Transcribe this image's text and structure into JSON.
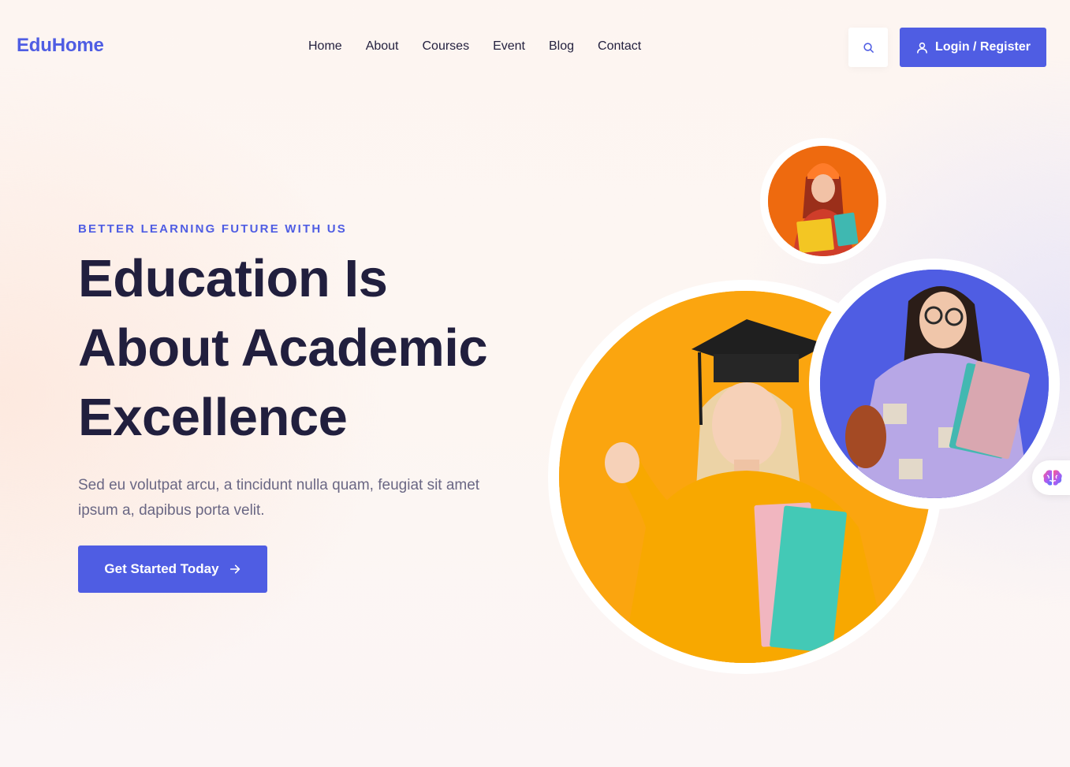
{
  "header": {
    "logo": "EduHome",
    "nav": [
      "Home",
      "About",
      "Courses",
      "Event",
      "Blog",
      "Contact"
    ],
    "login_label": "Login / Register"
  },
  "hero": {
    "eyebrow": "BETTER LEARNING FUTURE WITH US",
    "headline": [
      "Education Is",
      "About Academic",
      "Excellence"
    ],
    "description": "Sed eu volutpat arcu, a tincidunt nulla quam, feugiat sit amet ipsum a, dapibus porta velit.",
    "cta_label": "Get Started Today"
  },
  "images": {
    "small": "student-orange-beanie",
    "big": "student-graduation-cap",
    "mid": "student-glasses-books"
  },
  "colors": {
    "accent": "#4f5de3",
    "heading": "#211f3e",
    "orange": "#fba50f",
    "deep_orange": "#ee6a0f"
  }
}
